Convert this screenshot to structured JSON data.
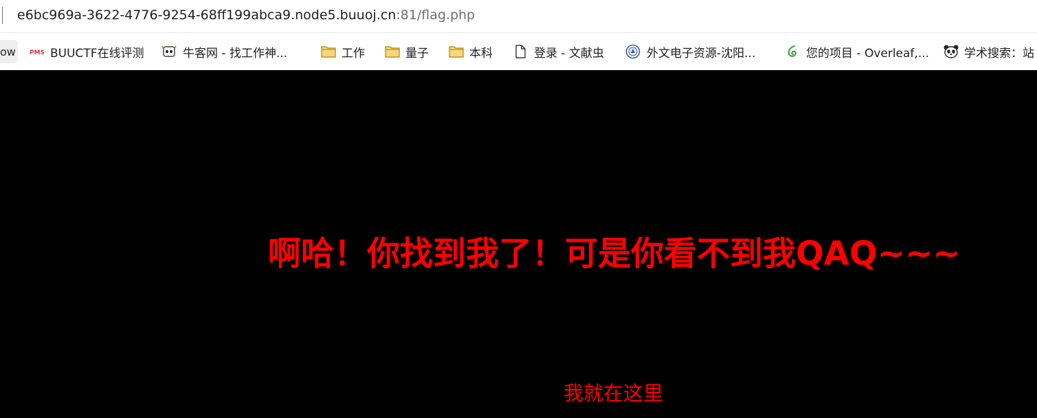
{
  "browser": {
    "url_host": "e6bc969a-3622-4776-9254-68ff199abca9.node5.buuoj.cn",
    "url_rest": ":81/flag.php"
  },
  "bookmarks": [
    {
      "label": "ow",
      "icon": "truncated-bookmark-icon"
    },
    {
      "label": "BUUCTF在线评测",
      "icon": "buuctf-favicon"
    },
    {
      "label": "牛客网 - 找工作神...",
      "icon": "nowcoder-favicon"
    },
    {
      "label": "工作",
      "icon": "folder-icon"
    },
    {
      "label": "量子",
      "icon": "folder-icon"
    },
    {
      "label": "本科",
      "icon": "folder-icon"
    },
    {
      "label": "登录 - 文献虫",
      "icon": "document-icon"
    },
    {
      "label": "外文电子资源-沈阳...",
      "icon": "university-seal-icon"
    },
    {
      "label": "您的项目 - Overleaf,...",
      "icon": "overleaf-leaf-icon"
    },
    {
      "label": "学术搜索：站",
      "icon": "panda-icon"
    }
  ],
  "page": {
    "headline": "啊哈！你找到我了！可是你看不到我QAQ~~~",
    "hint": "我就在这里",
    "text_color": "#ff0000",
    "background": "#000000"
  }
}
